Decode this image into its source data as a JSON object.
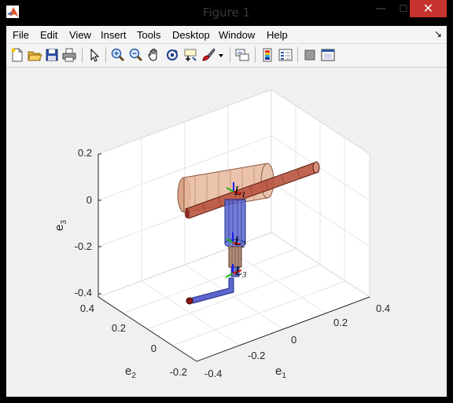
{
  "window": {
    "title": "Figure 1",
    "minimize_symbol": "—",
    "maximize_symbol": "☐",
    "close_symbol": "✕"
  },
  "menu": {
    "items": [
      "File",
      "Edit",
      "View",
      "Insert",
      "Tools",
      "Desktop",
      "Window",
      "Help"
    ],
    "undock_symbol": "↘"
  },
  "toolbar": {
    "tools": [
      "new-figure-icon",
      "open-file-icon",
      "save-icon",
      "print-icon",
      "edit-plot-icon",
      "zoom-in-icon",
      "zoom-out-icon",
      "pan-icon",
      "rotate-3d-icon",
      "data-cursor-icon",
      "brush-icon",
      "brush-dropdown-icon",
      "link-plot-icon",
      "insert-colorbar-icon",
      "insert-legend-icon",
      "hide-plot-tools-icon",
      "show-plot-tools-icon"
    ]
  },
  "colors": {
    "titlebar_bg": "#000000",
    "close_bg": "#c7332e",
    "figure_bg": "#f0f0f0",
    "link_blue": "#3a48c8",
    "link_brown": "#c08a6e",
    "link_red": "#9a3a2e",
    "end_effector": "#8b1414"
  },
  "axes": {
    "e1": {
      "label": "e",
      "subscript": "1",
      "ticks": [
        "-0.4",
        "-0.2",
        "0",
        "0.2",
        "0.4"
      ]
    },
    "e2": {
      "label": "e",
      "subscript": "2",
      "ticks": [
        "-0.2",
        "0",
        "0.2",
        "0.4"
      ]
    },
    "e3": {
      "label": "e",
      "subscript": "3",
      "ticks": [
        "-0.4",
        "-0.2",
        "0",
        "0.2"
      ]
    }
  },
  "links": [
    {
      "label": "L",
      "subscript": "1"
    },
    {
      "label": "L",
      "subscript": "2"
    },
    {
      "label": "L",
      "subscript": "3"
    }
  ]
}
